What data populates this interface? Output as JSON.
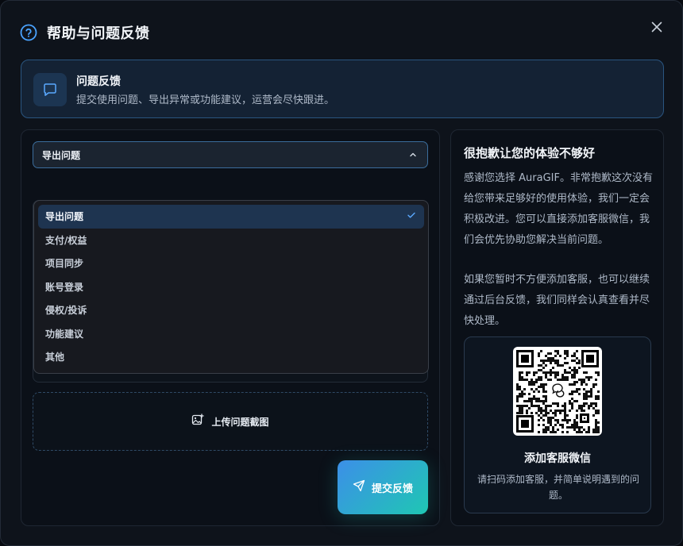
{
  "dialog": {
    "title": "帮助与问题反馈",
    "close_icon": "close-icon",
    "help_icon": "help-circle-icon"
  },
  "banner": {
    "icon": "message-square-icon",
    "title": "问题反馈",
    "description": "提交使用问题、导出异常或功能建议，运营会尽快跟进。"
  },
  "form": {
    "category_select": {
      "value": "导出问题",
      "expanded": true,
      "options": [
        {
          "label": "导出问题",
          "selected": true
        },
        {
          "label": "支付/权益",
          "selected": false
        },
        {
          "label": "项目同步",
          "selected": false
        },
        {
          "label": "账号登录",
          "selected": false
        },
        {
          "label": "侵权/投诉",
          "selected": false
        },
        {
          "label": "功能建议",
          "selected": false
        },
        {
          "label": "其他",
          "selected": false
        }
      ]
    },
    "upload_label": "上传问题截图",
    "submit_label": "提交反馈"
  },
  "support": {
    "title": "很抱歉让您的体验不够好",
    "paragraph1": "感谢您选择 AuraGIF。非常抱歉这次没有给您带来足够好的使用体验，我们一定会积极改进。您可以直接添加客服微信，我们会优先协助您解决当前问题。",
    "paragraph2": "如果您暂时不方便添加客服，也可以继续通过后台反馈，我们同样会认真查看并尽快处理。",
    "qr_title": "添加客服微信",
    "qr_desc": "请扫码添加客服，并简单说明遇到的问题。"
  },
  "colors": {
    "accent": "#3b8be6",
    "gradient_end": "#1fc7b3",
    "panel": "#0b1018",
    "banner_border": "#2a5580"
  }
}
